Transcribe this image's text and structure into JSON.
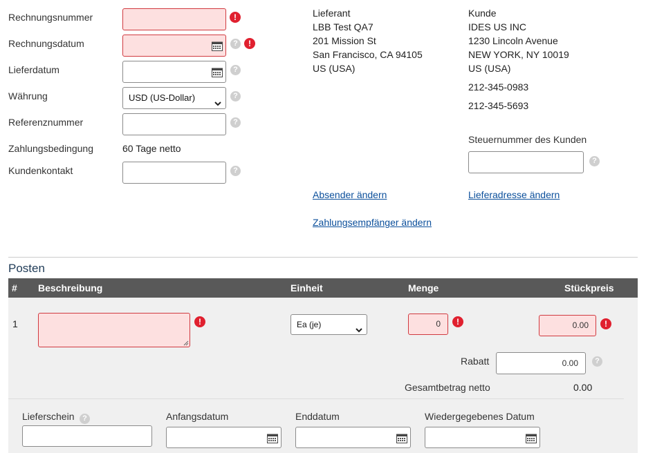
{
  "form": {
    "invoice_number_label": "Rechnungsnummer",
    "invoice_date_label": "Rechnungsdatum",
    "delivery_date_label": "Lieferdatum",
    "currency_label": "Währung",
    "currency_value": "USD (US-Dollar)",
    "reference_label": "Referenznummer",
    "payment_terms_label": "Zahlungsbedingung",
    "payment_terms_value": "60 Tage netto",
    "customer_contact_label": "Kundenkontakt"
  },
  "supplier": {
    "heading": "Lieferant",
    "name": "LBB Test QA7",
    "street": "201 Mission St",
    "city": "San Francisco, CA 94105",
    "country": "US (USA)",
    "change_sender_link": "Absender ändern",
    "change_payee_link": "Zahlungsempfänger ändern"
  },
  "customer": {
    "heading": "Kunde",
    "name": "IDES US INC",
    "street": "1230 Lincoln Avenue",
    "city": "NEW YORK, NY 10019",
    "country": "US (USA)",
    "phone1": "212-345-0983",
    "phone2": "212-345-5693",
    "tax_label": "Steuernummer des Kunden",
    "change_delivery_link": "Lieferadresse ändern"
  },
  "items": {
    "section_title": "Posten",
    "columns": [
      "#",
      "Beschreibung",
      "Einheit",
      "Menge",
      "Stückpreis"
    ],
    "row": {
      "number": "1",
      "unit": "Ea (je)",
      "quantity": "0",
      "unit_price": "0.00",
      "discount_label": "Rabatt",
      "discount_value": "0.00",
      "net_total_label": "Gesamtbetrag netto",
      "net_total_value": "0.00"
    },
    "sub": {
      "delivery_note_label": "Lieferschein",
      "start_date_label": "Anfangsdatum",
      "end_date_label": "Enddatum",
      "repeated_date_label": "Wiedergegebenes Datum"
    }
  },
  "icons": {
    "help": "?",
    "error": "!"
  },
  "colors": {
    "error_bg": "#fde0e0",
    "error_red": "#e0202f",
    "link": "#0b4f9b",
    "header_bg": "#595959"
  }
}
